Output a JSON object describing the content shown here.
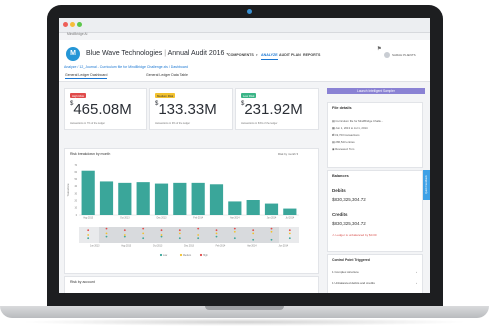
{
  "app": {
    "window_title": "MindBridge Ai",
    "company": "Blue Wave Technologies",
    "audit": "Annual Audit 2016"
  },
  "nav": [
    "COMPONENTS",
    "ANALYZE",
    "AUDIT PLAN",
    "REPORTS"
  ],
  "user": "SARAH PLIENTS",
  "breadcrumb": "Analyze  /  12_Journal - Curriculum file for MindBridge Challenge.xls  /  Dashboard",
  "subtabs": [
    "General Ledger Dashboard",
    "General Ledger Data Table"
  ],
  "launch_button": "Launch Intelligent Sampler",
  "risk_cards": [
    {
      "badge": "High Risk",
      "color": "#e04b4b",
      "currency": "$",
      "amount": "465.08M",
      "note": "transactions in 7% of the ledger"
    },
    {
      "badge": "Medium Risk",
      "color": "#f2c12e",
      "currency": "$",
      "amount": "133.33M",
      "note": "transactions in 9% of the ledger"
    },
    {
      "badge": "Low Risk",
      "color": "#3ab486",
      "currency": "$",
      "amount": "231.92M",
      "note": "transactions in 84% of the ledger"
    }
  ],
  "risk_chart": {
    "title": "Risk breakdown by month",
    "dropdown": "Risk by month ▾",
    "legend": [
      "Low",
      "Medium",
      "High"
    ]
  },
  "chart_data": {
    "type": "bar",
    "title": "Risk breakdown by month",
    "ylabel": "Transactions",
    "categories": [
      "Aug 2013",
      "Sep 2013",
      "Oct 2013",
      "Nov 2013",
      "Dec 2013",
      "Jan 2014",
      "Feb 2014",
      "Mar 2014",
      "Apr 2014",
      "May 2014",
      "Jun 2014",
      "Jul 2014"
    ],
    "tick_labels": [
      "Aug 2013",
      "Oct 2013",
      "Dec 2013",
      "Feb 2014",
      "Apr 2014",
      "Jun 2014",
      "Jul 2014"
    ],
    "values": [
      62,
      47,
      45,
      46,
      44,
      45,
      45,
      43,
      19,
      21,
      16,
      9
    ],
    "ylim": [
      0,
      70
    ],
    "overview": {
      "tick_labels": [
        "Jun 2013",
        "Aug 2013",
        "Oct 2013",
        "Dec 2013",
        "Feb 2014",
        "Apr 2014",
        "Jun 2014"
      ],
      "low": [
        3,
        4,
        4,
        3,
        4,
        3,
        3,
        4,
        3,
        2,
        2,
        3
      ],
      "medium": [
        5,
        6,
        5,
        6,
        5,
        6,
        5,
        6,
        7,
        6,
        7,
        6
      ],
      "high": [
        8,
        9,
        8,
        9,
        8,
        8,
        9,
        8,
        9,
        8,
        9,
        8
      ]
    }
  },
  "risk_by_account_title": "Risk by account",
  "file_details": {
    "title": "File details",
    "lines": [
      "Curriculum file for MindBridge Challe...",
      "Jun 1, 2013 to Jul 1, 2014",
      "19,703 transactions",
      "286,543 entries",
      "Reviewed: Tom"
    ]
  },
  "balances": {
    "title": "Balances",
    "debits_label": "Debits",
    "debits_value": "$830,325,304.72",
    "credits_label": "Credits",
    "credits_value": "$830,325,304.72",
    "warning": "Ledger is unbalanced by $0.00"
  },
  "control_points": {
    "title": "Control Point Triggered",
    "items": [
      "1 Complex structure",
      "1 Unbalanced debits and credits"
    ]
  },
  "feedback_tab": "Quick Feedback",
  "colors": {
    "accent": "#1976d2",
    "bar": "#3aa69a",
    "low": "#3aa69a",
    "medium": "#f2c12e",
    "high": "#e04b4b",
    "purple": "#8a82d4"
  }
}
